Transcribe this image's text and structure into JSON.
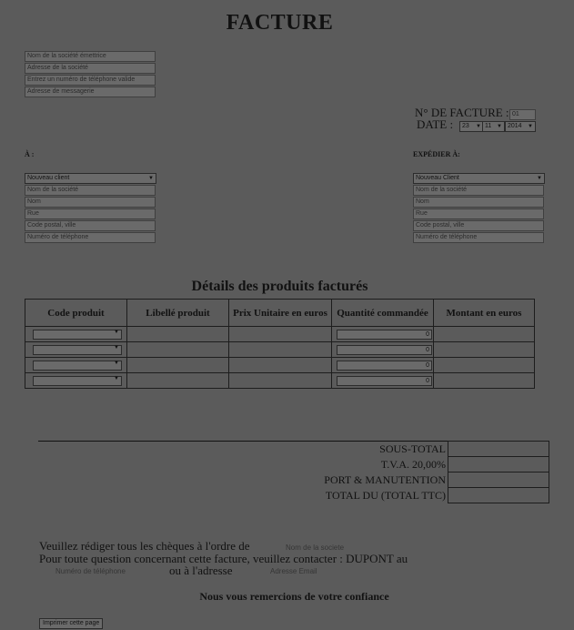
{
  "title": "FACTURE",
  "issuer": {
    "company_name": "Nom de la société émettrice",
    "address": "Adresse de la société",
    "phone": "Entrez un numéro de téléphone valide",
    "email": "Adresse de messagerie"
  },
  "invoice": {
    "number_label": "N° DE FACTURE :",
    "number_value": "01",
    "date_label": "DATE :",
    "day": "23",
    "month": "11",
    "year": "2014"
  },
  "to": {
    "label": "À :",
    "client_select": "Nouveau client",
    "company": "Nom de la société",
    "name": "Nom",
    "street": "Rue",
    "postal_city": "Code postal, ville",
    "phone": "Numéro de téléphone"
  },
  "ship_to": {
    "label": "EXPÉDIER À:",
    "client_select": "Nouveau Client",
    "company": "Nom de la société",
    "name": "Nom",
    "street": "Rue",
    "postal_city": "Code postal, ville",
    "phone": "Numéro de téléphone"
  },
  "products": {
    "section_title": "Détails des produits facturés",
    "headers": {
      "code": "Code produit",
      "label": "Libellé produit",
      "price": "Prix   Unitaire en euros",
      "qty": "Quantité commandée",
      "amount": "Montant en euros"
    },
    "rows": [
      {
        "qty": "0"
      },
      {
        "qty": "0"
      },
      {
        "qty": "0"
      },
      {
        "qty": "0"
      }
    ]
  },
  "totals": {
    "subtotal": "SOUS-TOTAL",
    "vat": "T.V.A. 20,00%",
    "shipping": "PORT & MANUTENTION",
    "total": "TOTAL DU (TOTAL TTC)"
  },
  "footer": {
    "checks_text": "Veuillez rédiger tous les chèques à l'ordre de",
    "checks_placeholder": "Nom de la societe",
    "contact_text": "Pour toute question concernant cette facture, veuillez contacter : DUPONT au",
    "contact_phone_placeholder": "Numéro de téléphone",
    "or_address": "ou à l'adresse",
    "email_placeholder": "Adresse Email",
    "thanks": "Nous vous remercions de votre confiance",
    "print_button": "Imprimer cette page"
  }
}
